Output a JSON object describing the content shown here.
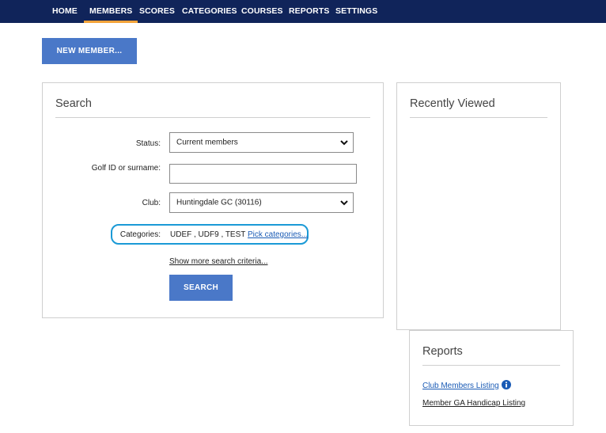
{
  "nav": {
    "items": [
      "HOME",
      "MEMBERS",
      "SCORES",
      "CATEGORIES",
      "COURSES",
      "REPORTS",
      "SETTINGS"
    ],
    "active": "MEMBERS"
  },
  "new_member_button": "NEW MEMBER...",
  "search": {
    "title": "Search",
    "status_label": "Status:",
    "status_value": "Current members",
    "golfid_label": "Golf ID or surname:",
    "golfid_value": "",
    "club_label": "Club:",
    "club_value": "Huntingdale GC (30116)",
    "categories_label": "Categories:",
    "categories_value": "UDEF , UDF9 , TEST",
    "pick_categories": "Pick categories...",
    "show_more": "Show more search criteria...",
    "search_button": "SEARCH"
  },
  "recently_viewed": {
    "title": "Recently Viewed"
  },
  "reports": {
    "title": "Reports",
    "links": [
      "Club Members Listing",
      "Member GA Handicap Listing"
    ]
  },
  "colors": {
    "nav_bg": "#10245a",
    "active_underline": "#f2a33a",
    "button_bg": "#4a78c8",
    "highlight_outline": "#1b9ad6",
    "link": "#1a5bb5"
  }
}
